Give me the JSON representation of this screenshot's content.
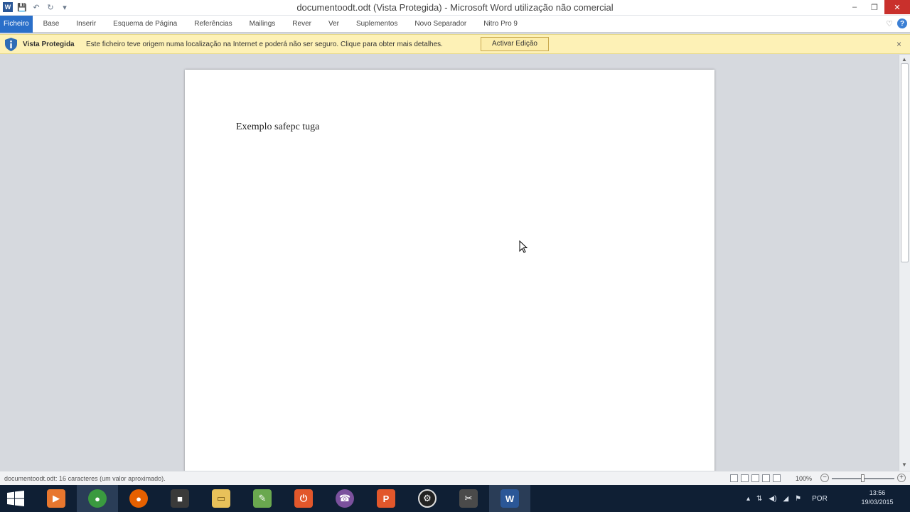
{
  "window": {
    "title": "documentoodt.odt (Vista Protegida) - Microsoft Word utilização não comercial",
    "app_icon": "W",
    "controls": {
      "minimize": "–",
      "restore": "❐",
      "close": "✕"
    }
  },
  "quick_access": {
    "save": "💾",
    "undo": "↶",
    "redo": "↻",
    "customize": "▾"
  },
  "ribbon": {
    "tabs": [
      {
        "label": "Ficheiro"
      },
      {
        "label": "Base"
      },
      {
        "label": "Inserir"
      },
      {
        "label": "Esquema de Página"
      },
      {
        "label": "Referências"
      },
      {
        "label": "Mailings"
      },
      {
        "label": "Rever"
      },
      {
        "label": "Ver"
      },
      {
        "label": "Suplementos"
      },
      {
        "label": "Novo Separador"
      },
      {
        "label": "Nitro Pro 9"
      }
    ],
    "help": "?",
    "minimize_ribbon": "♡"
  },
  "protected_view": {
    "title": "Vista Protegida",
    "message": "Este ficheiro teve origem numa localização na Internet e poderá não ser seguro. Clique para obter mais detalhes.",
    "button": "Activar Edição",
    "close": "×"
  },
  "document": {
    "text": "Exemplo safepc tuga"
  },
  "scrollbar": {
    "up": "▲",
    "down": "▼"
  },
  "status": {
    "text": "documentoodt.odt: 16 caracteres (um valor aproximado).",
    "zoom": "100%",
    "zoom_minus": "−",
    "zoom_plus": "+"
  },
  "taskbar": {
    "apps": [
      {
        "name": "media-player",
        "glyph": "▶",
        "color": "#e8772e"
      },
      {
        "name": "chrome",
        "glyph": "●",
        "color": "#3a9a3f"
      },
      {
        "name": "firefox",
        "glyph": "●",
        "color": "#e66000"
      },
      {
        "name": "camera",
        "glyph": "■",
        "color": "#3a3a3a"
      },
      {
        "name": "file-explorer",
        "glyph": "▭",
        "color": "#e8c15a"
      },
      {
        "name": "notepad",
        "glyph": "✎",
        "color": "#6aa84f"
      },
      {
        "name": "power",
        "glyph": "⏻",
        "color": "#e2572b"
      },
      {
        "name": "viber",
        "glyph": "☎",
        "color": "#7b519d"
      },
      {
        "name": "pdf",
        "glyph": "P",
        "color": "#e2572b"
      },
      {
        "name": "settings",
        "glyph": "⚙",
        "color": "#222222"
      },
      {
        "name": "tools",
        "glyph": "✂",
        "color": "#4a4a4a"
      },
      {
        "name": "word",
        "glyph": "W",
        "color": "#2b5797"
      }
    ],
    "tray": {
      "show_hidden": "▴",
      "network": "⇅",
      "sound": "◀)",
      "signal": "◢",
      "flag": "⚑",
      "language": "POR"
    },
    "clock": {
      "time": "13:56",
      "date": "19/03/2015"
    }
  }
}
